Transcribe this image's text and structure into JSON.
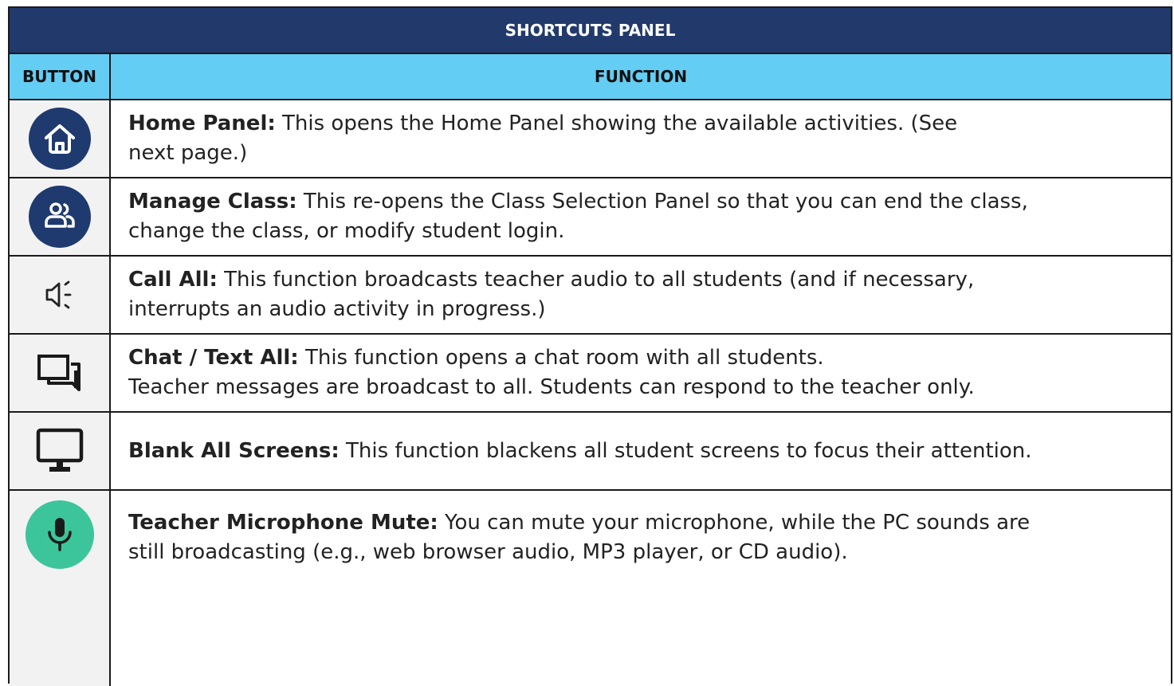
{
  "title": "SHORTCUTS PANEL",
  "headers": {
    "button": "BUTTON",
    "function": "FUNCTION"
  },
  "rows": [
    {
      "icon": "home-icon",
      "label": "Home Panel:",
      "line1": " This opens the Home Panel showing the available activities.  (See",
      "line2": "next page.)"
    },
    {
      "icon": "manage-class-icon",
      "label": "Manage Class:",
      "line1": " This re-opens the Class Selection Panel so that you can end the class,",
      "line2": "change the class, or modify student login."
    },
    {
      "icon": "speaker-icon",
      "label": "Call All:",
      "line1": " This function broadcasts teacher audio to all students (and if necessary,",
      "line2": "interrupts an audio activity in progress.)"
    },
    {
      "icon": "chat-icon",
      "label": "Chat / Text All:",
      "line1": " This function opens a chat room with all students.",
      "line2": "Teacher messages are broadcast to all. Students can respond to the teacher only."
    },
    {
      "icon": "monitor-icon",
      "label": "Blank All Screens:",
      "line1": " This function blackens all student screens to focus their attention.",
      "line2": ""
    },
    {
      "icon": "microphone-icon",
      "label": "Teacher Microphone Mute:",
      "line1": " You can mute your microphone, while the PC sounds are",
      "line2": "still broadcasting (e.g., web browser audio, MP3 player, or CD audio)."
    }
  ],
  "colors": {
    "title_bg": "#223a6b",
    "header_bg": "#64cdf3",
    "circle_blue": "#1f3a6e",
    "mic_green": "#3cc59a"
  }
}
